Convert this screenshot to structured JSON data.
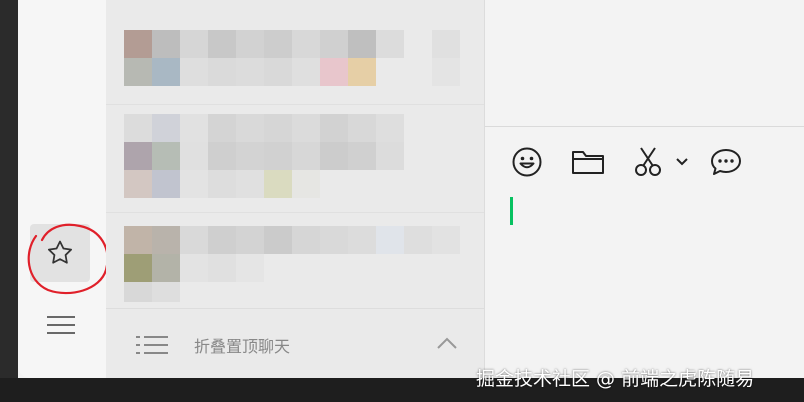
{
  "sidebar": {
    "items": [
      {
        "name": "favorites",
        "icon": "star-icon"
      },
      {
        "name": "more",
        "icon": "hamburger-menu-icon"
      }
    ],
    "annotation_color": "#e0202a"
  },
  "chat_list": {
    "fold_bar": {
      "label": "折叠置顶聊天",
      "icon": "list-icon",
      "chevron": "chevron-up-icon"
    }
  },
  "toolbar": {
    "tools": [
      {
        "name": "emoji",
        "icon": "smiley-icon"
      },
      {
        "name": "file",
        "icon": "folder-icon"
      },
      {
        "name": "screenshot",
        "icon": "scissors-icon"
      },
      {
        "name": "screenshot-options",
        "icon": "chevron-down-icon"
      },
      {
        "name": "chat-history",
        "icon": "chat-bubble-icon"
      }
    ],
    "cursor_color": "#07c160"
  },
  "watermark": {
    "text": "掘金技术社区 @ 前端之虎陈随易"
  }
}
